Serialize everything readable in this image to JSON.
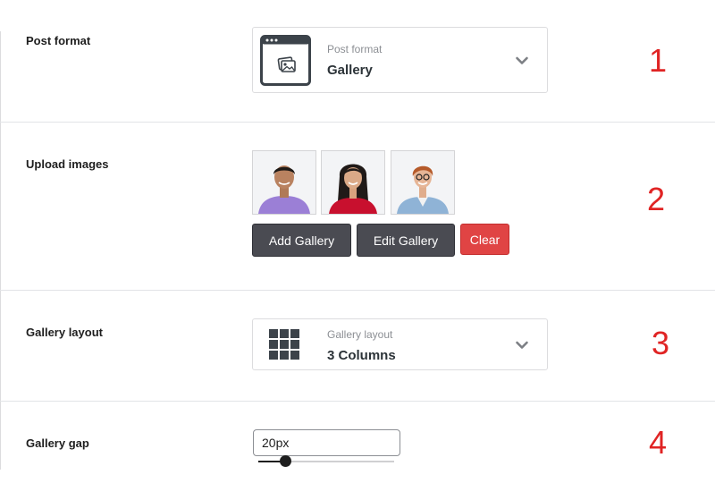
{
  "rows": {
    "post_format": {
      "label": "Post format",
      "step": "1",
      "select": {
        "caption": "Post format",
        "value": "Gallery"
      }
    },
    "upload_images": {
      "label": "Upload images",
      "step": "2",
      "buttons": {
        "add": "Add Gallery",
        "edit": "Edit Gallery",
        "clear": "Clear"
      },
      "thumbnails": [
        "person-purple-shirt",
        "person-red-top",
        "person-denim-jacket"
      ]
    },
    "gallery_layout": {
      "label": "Gallery layout",
      "step": "3",
      "select": {
        "caption": "Gallery layout",
        "value": "3 Columns"
      }
    },
    "gallery_gap": {
      "label": "Gallery gap",
      "step": "4",
      "input_value": "20px",
      "slider_level": 0.2
    }
  },
  "colors": {
    "step_number": "#e02424",
    "button_dark": "#4a4b52",
    "button_clear": "#e04444",
    "icon_stroke": "#3c434a"
  }
}
